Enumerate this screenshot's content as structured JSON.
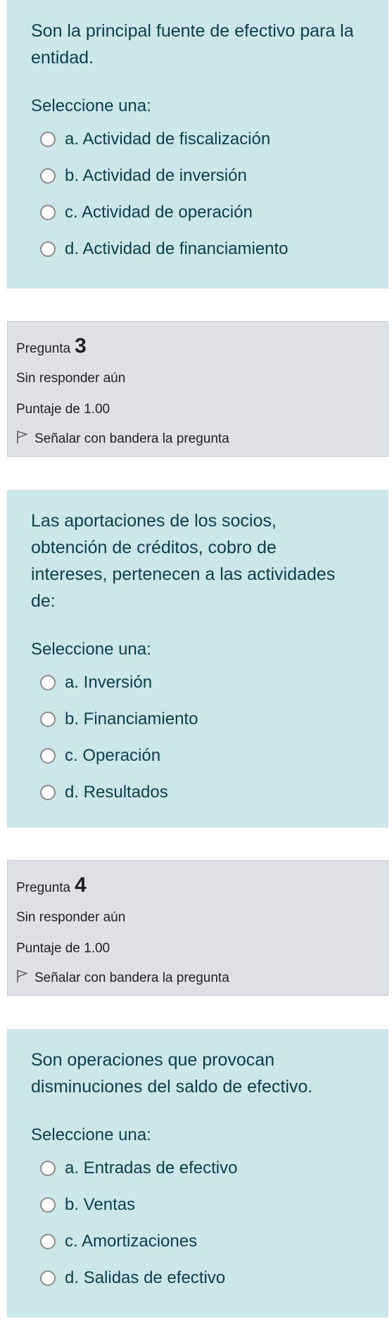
{
  "questions": [
    {
      "text": "Son la principal fuente de efectivo para la entidad.",
      "prompt": "Seleccione una:",
      "options": [
        "a. Actividad de fiscalización",
        "b. Actividad de inversión",
        "c. Actividad de operación",
        "d. Actividad de financiamiento"
      ]
    },
    {
      "info": {
        "label": "Pregunta",
        "number": "3",
        "status": "Sin responder aún",
        "score": "Puntaje de 1.00",
        "flag": "Señalar con bandera la pregunta"
      },
      "text": "Las aportaciones de los socios, obtención de créditos, cobro de intereses, pertenecen a las actividades de:",
      "prompt": "Seleccione una:",
      "options": [
        "a. Inversión",
        "b. Financiamiento",
        "c. Operación",
        "d. Resultados"
      ]
    },
    {
      "info": {
        "label": "Pregunta",
        "number": "4",
        "status": "Sin responder aún",
        "score": "Puntaje de 1.00",
        "flag": "Señalar con bandera la pregunta"
      },
      "text": "Son operaciones que provocan disminuciones del saldo de efectivo.",
      "prompt": "Seleccione una:",
      "options": [
        "a. Entradas de efectivo",
        "b. Ventas",
        "c. Amortizaciones",
        "d. Salidas de efectivo"
      ]
    }
  ]
}
